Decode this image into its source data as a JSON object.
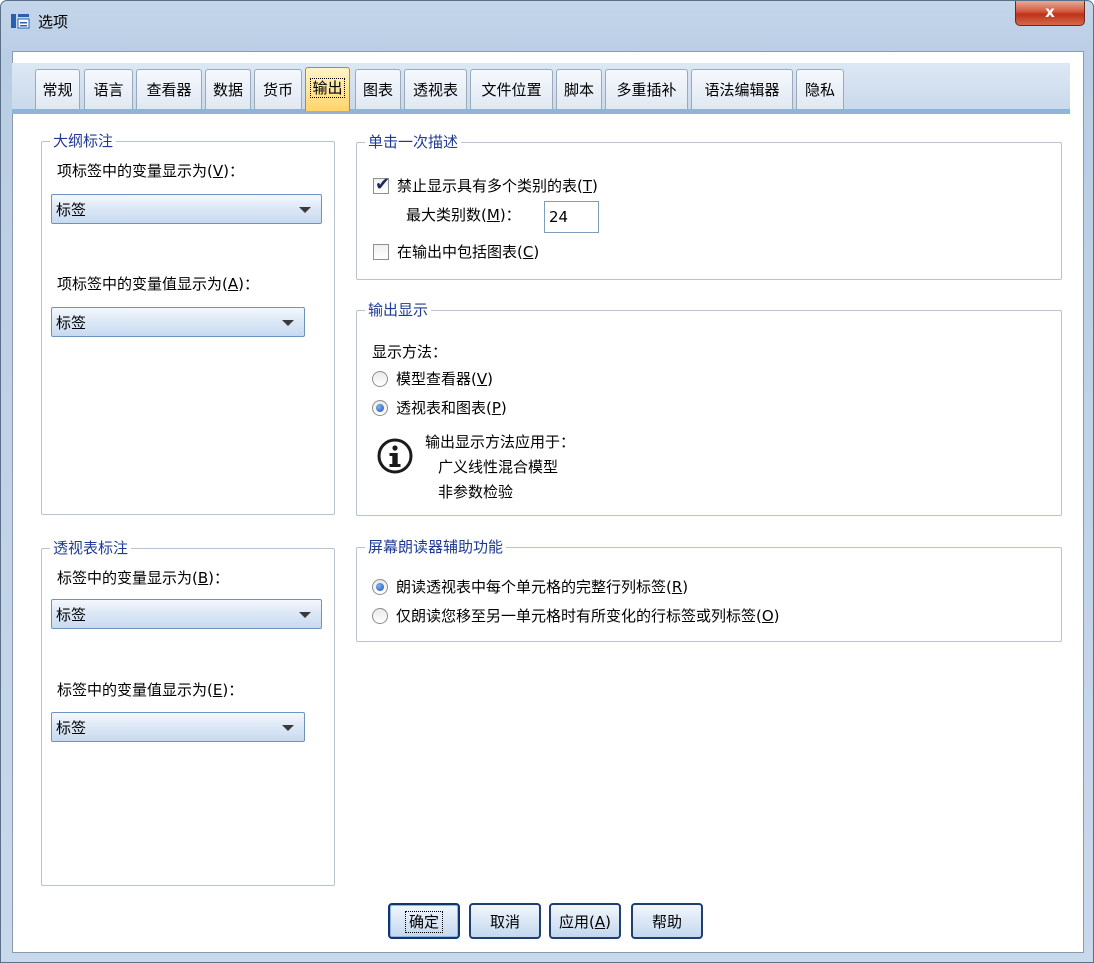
{
  "window": {
    "title": "选项",
    "close_glyph": "x",
    "app_icon": "spss-options-icon"
  },
  "tabs": [
    {
      "label": "常规"
    },
    {
      "label": "语言"
    },
    {
      "label": "查看器"
    },
    {
      "label": "数据"
    },
    {
      "label": "货币"
    },
    {
      "label": "输出",
      "active": true
    },
    {
      "label": "图表"
    },
    {
      "label": "透视表"
    },
    {
      "label": "文件位置"
    },
    {
      "label": "脚本"
    },
    {
      "label": "多重插补"
    },
    {
      "label": "语法编辑器"
    },
    {
      "label": "隐私"
    }
  ],
  "outline_labeling": {
    "title": "大纲标注",
    "var_label": {
      "text": "项标签中的变量显示为(",
      "key": "V",
      "tail": ")："
    },
    "var_value": "标签",
    "val_label": {
      "text": "项标签中的变量值显示为(",
      "key": "A",
      "tail": ")："
    },
    "val_value": "标签"
  },
  "pivot_labeling": {
    "title": "透视表标注",
    "var_label": {
      "text": "标签中的变量显示为(",
      "key": "B",
      "tail": ")："
    },
    "var_value": "标签",
    "val_label": {
      "text": "标签中的变量值显示为(",
      "key": "E",
      "tail": ")："
    },
    "val_value": "标签"
  },
  "one_click": {
    "title": "单击一次描述",
    "suppress": {
      "text": "禁止显示具有多个类别的表(",
      "key": "T",
      "tail": ")",
      "checked": true
    },
    "max_categories": {
      "text": "最大类别数(",
      "key": "M",
      "tail": ")：",
      "value": "24"
    },
    "include_charts": {
      "text": "在输出中包括图表(",
      "key": "C",
      "tail": ")",
      "checked": false
    }
  },
  "output_display": {
    "title": "输出显示",
    "method_label": "显示方法：",
    "model_viewer": {
      "text": "模型查看器(",
      "key": "V",
      "tail": ")",
      "selected": false
    },
    "pivot_charts": {
      "text": "透视表和图表(",
      "key": "P",
      "tail": ")",
      "selected": true
    },
    "info_heading": "输出显示方法应用于：",
    "info_items": [
      "广义线性混合模型",
      "非参数检验"
    ],
    "info_icon": "info-icon"
  },
  "screen_reader": {
    "title": "屏幕朗读器辅助功能",
    "full_labels": {
      "text": "朗读透视表中每个单元格的完整行列标签(",
      "key": "R",
      "tail": ")",
      "selected": true
    },
    "changed_labels": {
      "text": "仅朗读您移至另一单元格时有所变化的行标签或列标签(",
      "key": "O",
      "tail": ")",
      "selected": false
    }
  },
  "buttons": {
    "ok": "确定",
    "cancel": "取消",
    "apply": {
      "text": "应用(",
      "key": "A",
      "tail": ")"
    },
    "help": "帮助"
  },
  "colors": {
    "group_label": "#1e3a96",
    "active_tab": "#ffd56a",
    "close_button": "#c9402a"
  }
}
